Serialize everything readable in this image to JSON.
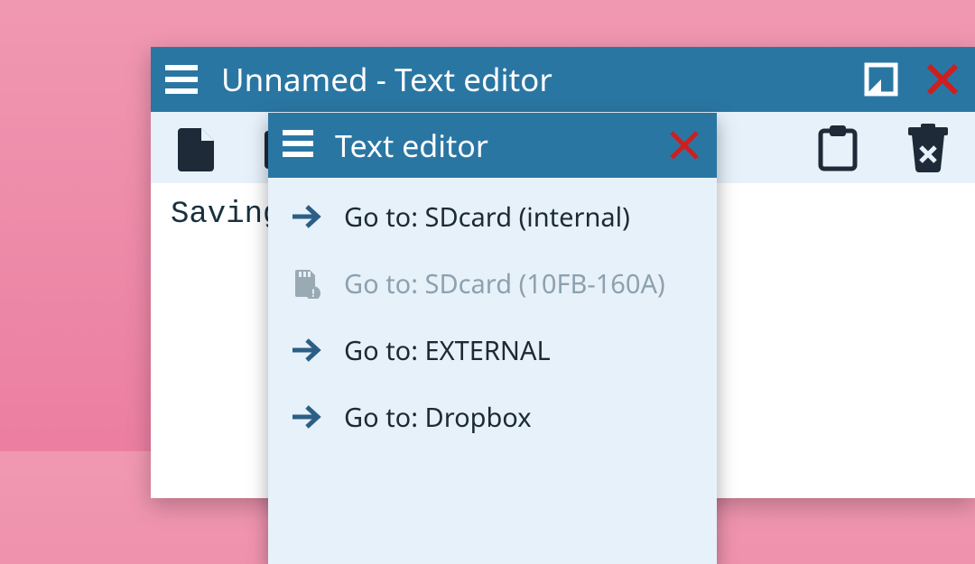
{
  "main_window": {
    "title": "Unnamed - Text editor"
  },
  "editor": {
    "content": "Saving"
  },
  "popup": {
    "title": "Text editor",
    "items": [
      {
        "label": "Go to: SDcard (internal)",
        "disabled": false,
        "icon": "arrow"
      },
      {
        "label": "Go to: SDcard (10FB-160A)",
        "disabled": true,
        "icon": "sdcard"
      },
      {
        "label": "Go to: EXTERNAL",
        "disabled": false,
        "icon": "arrow"
      },
      {
        "label": "Go to: Dropbox",
        "disabled": false,
        "icon": "arrow"
      }
    ]
  }
}
